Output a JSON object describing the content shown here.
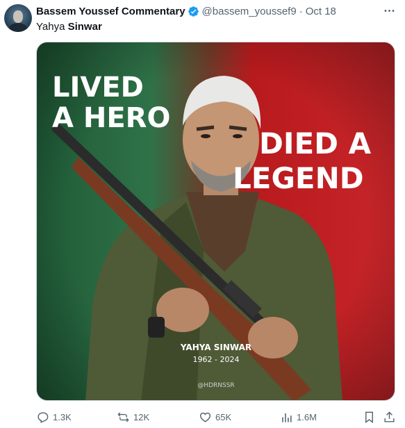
{
  "tweet": {
    "display_name": "Bassem Youssef Commentary",
    "handle": "@bassem_youssef9",
    "separator": "·",
    "date": "Oct 18",
    "text_normal": "Yahya ",
    "text_bold": "Sinwar",
    "more_icon": "more-horizontal-icon",
    "verified_color": "#1d9bf0"
  },
  "media": {
    "headline_left": [
      "LIVED",
      "A HERO"
    ],
    "headline_right": [
      "DIED A",
      "LEGEND"
    ],
    "caption_name": "YAHYA SINWAR",
    "caption_years": "1962 - 2024",
    "watermark": "@HDRNSSR",
    "colors": {
      "green": "#2f7248",
      "red": "#c01a1e"
    }
  },
  "actions": {
    "reply_count": "1.3K",
    "repost_count": "12K",
    "like_count": "65K",
    "views_count": "1.6M",
    "icons": [
      "reply-icon",
      "repost-icon",
      "like-icon",
      "views-icon",
      "bookmark-icon",
      "share-icon"
    ]
  }
}
